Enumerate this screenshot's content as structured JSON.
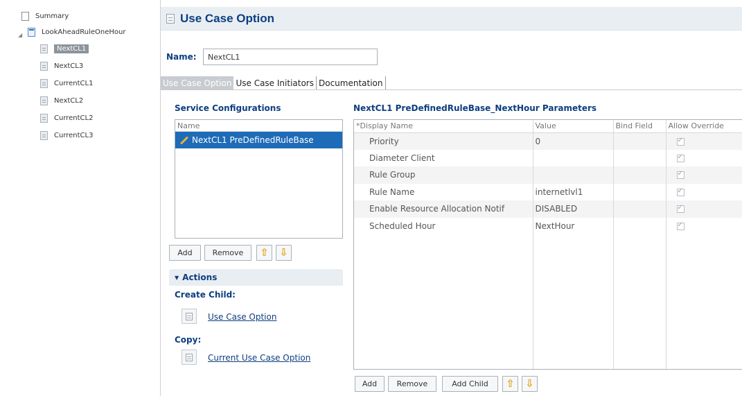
{
  "tree": {
    "items": [
      {
        "label": "Summary",
        "icon": "blank-document-icon"
      },
      {
        "label": "LookAheadRuleOneHour",
        "icon": "blue-document-icon"
      },
      {
        "label": "NextCL1",
        "icon": "grey-document-icon",
        "selected": true
      },
      {
        "label": "NextCL3",
        "icon": "grey-document-icon"
      },
      {
        "label": "CurrentCL1",
        "icon": "grey-document-icon"
      },
      {
        "label": "NextCL2",
        "icon": "grey-document-icon"
      },
      {
        "label": "CurrentCL2",
        "icon": "grey-document-icon"
      },
      {
        "label": "CurrentCL3",
        "icon": "grey-document-icon"
      }
    ]
  },
  "header": {
    "title": "Use Case Option"
  },
  "name_field": {
    "label": "Name:",
    "value": "NextCL1"
  },
  "tabs": [
    {
      "label": "Use Case Option",
      "active": true
    },
    {
      "label": "Use Case Initiators",
      "active": false
    },
    {
      "label": "Documentation",
      "active": false
    }
  ],
  "service_configurations": {
    "title": "Service Configurations",
    "column": "Name",
    "items": [
      "NextCL1 PreDefinedRuleBase"
    ],
    "buttons": {
      "add": "Add",
      "remove": "Remove"
    }
  },
  "actions": {
    "title": "Actions",
    "create_child_label": "Create Child:",
    "create_child_link": "Use Case Option",
    "copy_label": "Copy:",
    "copy_link": "Current Use Case Option"
  },
  "parameters": {
    "title": "NextCL1 PreDefinedRuleBase_NextHour Parameters",
    "columns": [
      "*Display Name",
      "Value",
      "Bind Field",
      "Allow Override"
    ],
    "rows": [
      {
        "name": "Priority",
        "value": "0",
        "bind": "",
        "override": true
      },
      {
        "name": "Diameter Client",
        "value": "",
        "bind": "",
        "override": true
      },
      {
        "name": "Rule Group",
        "value": "",
        "bind": "",
        "override": true
      },
      {
        "name": "Rule Name",
        "value": "internetlvl1",
        "bind": "",
        "override": true
      },
      {
        "name": "Enable Resource Allocation Notif",
        "value": "DISABLED",
        "bind": "",
        "override": true
      },
      {
        "name": "Scheduled Hour",
        "value": "NextHour",
        "bind": "",
        "override": true
      }
    ],
    "buttons": {
      "add": "Add",
      "remove": "Remove",
      "add_child": "Add Child"
    }
  },
  "colors": {
    "title_blue": "#0d3e80",
    "selection_blue": "#1e6bb8",
    "arrow_orange": "#e3a21a"
  }
}
